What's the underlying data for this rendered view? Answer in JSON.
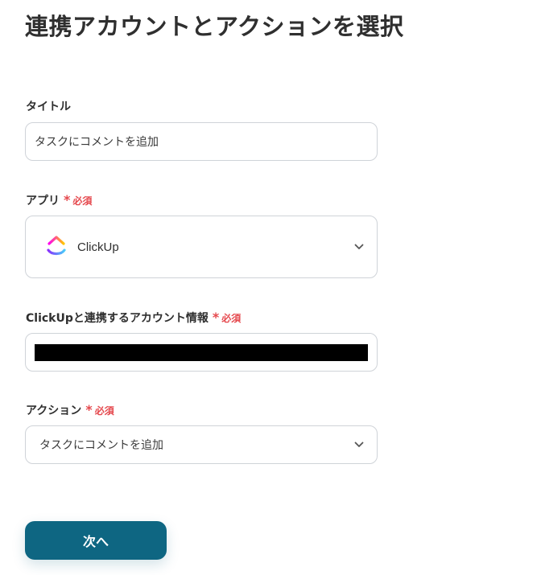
{
  "page": {
    "title": "連携アカウントとアクションを選択"
  },
  "form": {
    "title_field": {
      "label": "タイトル",
      "value": "タスクにコメントを追加"
    },
    "app_field": {
      "label": "アプリ",
      "required_mark": "*",
      "required_label": "必須",
      "selected_app": "ClickUp",
      "app_icon": "clickup-logo"
    },
    "account_field": {
      "label": "ClickUpと連携するアカウント情報",
      "required_mark": "*",
      "required_label": "必須"
    },
    "action_field": {
      "label": "アクション",
      "required_mark": "*",
      "required_label": "必須",
      "selected_action": "タスクにコメントを追加"
    },
    "next_button_label": "次へ"
  },
  "colors": {
    "primary_button": "#0e6682",
    "required_red": "#e5484d",
    "border": "#cfd3d8"
  }
}
